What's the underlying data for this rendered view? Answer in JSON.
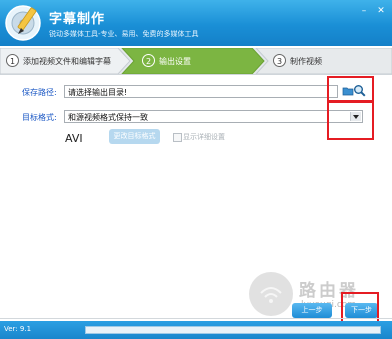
{
  "app": {
    "title": "字幕制作",
    "subtitle": "锐动多媒体工具-专业、易用、免费的多媒体工具",
    "version": "Ver: 9.1"
  },
  "steps": [
    {
      "num": "1",
      "label": "添加视频文件和编辑字幕",
      "active": false
    },
    {
      "num": "2",
      "label": "输出设置",
      "active": true
    },
    {
      "num": "3",
      "label": "制作视频",
      "active": false
    }
  ],
  "output": {
    "path_label": "保存路径:",
    "path_value": "请选择输出目录!",
    "format_label": "目标格式:",
    "format_value": "和源视频格式保持一致",
    "format_name": "AVI",
    "change_format_button": "更改目标格式",
    "show_details_label": "显示详细设置",
    "show_details_checked": false
  },
  "nav": {
    "prev_label": "上一步",
    "next_label": "下一步"
  },
  "progress": 0,
  "watermark": {
    "text": "路由器",
    "url": "luyouqi.com"
  },
  "colors": {
    "header": "#1a8fd6",
    "step_active": "#7cb542",
    "highlight": "#e51c23",
    "label": "#1a57c4"
  }
}
